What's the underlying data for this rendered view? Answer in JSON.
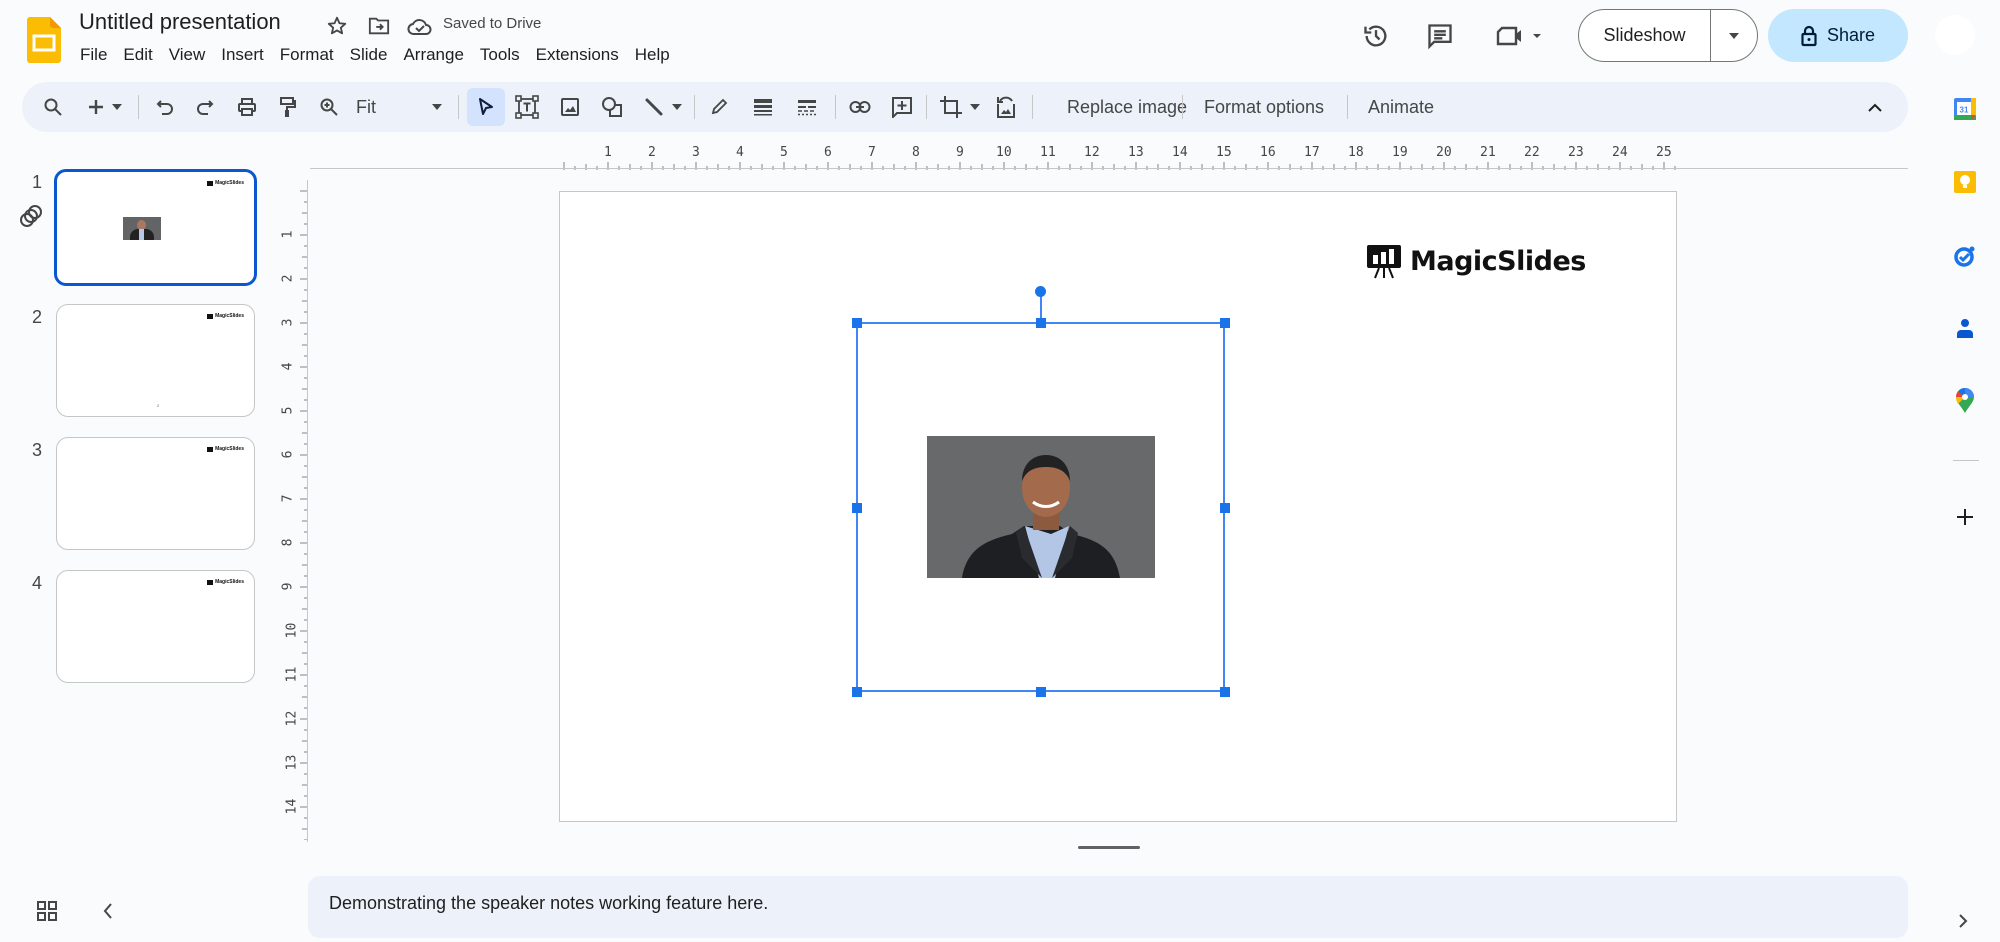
{
  "app": {
    "title": "Untitled presentation",
    "saved_status": "Saved to Drive",
    "icons": {
      "logo": "google-slides-logo",
      "star": "star-icon",
      "move": "move-to-folder-icon",
      "cloud": "cloud-saved-icon"
    }
  },
  "menubar": {
    "items": [
      "File",
      "Edit",
      "View",
      "Insert",
      "Format",
      "Slide",
      "Arrange",
      "Tools",
      "Extensions",
      "Help"
    ]
  },
  "header_actions": {
    "history_icon": "version-history-icon",
    "comments_icon": "comments-icon",
    "meet_icon": "video-call-icon",
    "slideshow_label": "Slideshow",
    "share_label": "Share"
  },
  "toolbar": {
    "zoom_value": "Fit",
    "replace_image": "Replace image",
    "format_options": "Format options",
    "animate": "Animate"
  },
  "filmstrip": {
    "slides": [
      {
        "number": "1",
        "selected": true,
        "has_photo": true
      },
      {
        "number": "2",
        "selected": false,
        "footer": "2"
      },
      {
        "number": "3",
        "selected": false
      },
      {
        "number": "4",
        "selected": false
      }
    ],
    "thumb_logo": "MagicSlides"
  },
  "rulers": {
    "horizontal": [
      "1",
      "2",
      "3",
      "4",
      "5",
      "6",
      "7",
      "8",
      "9",
      "10",
      "11",
      "12",
      "13",
      "14",
      "15",
      "16",
      "17",
      "18",
      "19",
      "20",
      "21",
      "22",
      "23",
      "24",
      "25"
    ],
    "vertical": [
      "1",
      "2",
      "3",
      "4",
      "5",
      "6",
      "7",
      "8",
      "9",
      "10",
      "11",
      "12",
      "13",
      "14"
    ]
  },
  "slide": {
    "brand_name": "MagicSlides",
    "image_description": "Portrait photo of smiling man in dark blazer and light blue shirt on gray background"
  },
  "notes": {
    "text": "Demonstrating the speaker notes working feature here."
  },
  "side_panel": {
    "apps": [
      "Calendar",
      "Keep",
      "Tasks",
      "Contacts",
      "Maps"
    ],
    "add_label": "Get add-ons"
  },
  "colors": {
    "accent": "#0b57d0",
    "selection": "#1a73e8",
    "share_bg": "#c2e7ff",
    "toolbar_bg": "#edf2fa"
  }
}
